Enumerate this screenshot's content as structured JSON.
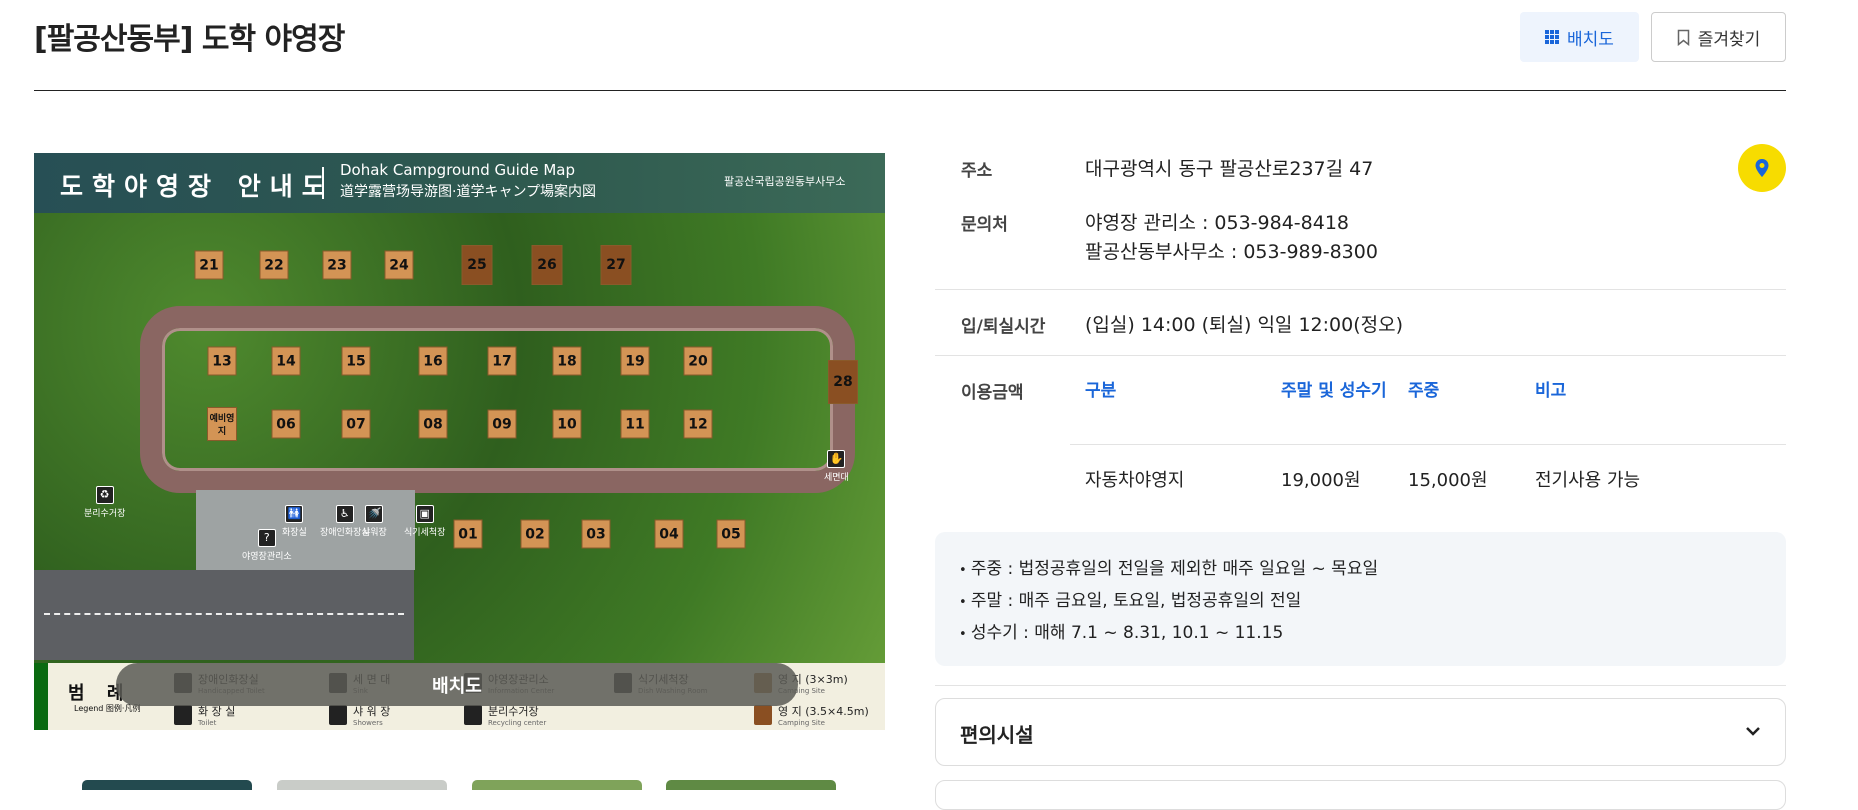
{
  "header": {
    "title": "[팔공산동부] 도학 야영장",
    "layout_button": "배치도",
    "favorite_button": "즐겨찾기"
  },
  "map": {
    "title_ko": "도학야영장 안내도",
    "title_en": "Dohak Campground Guide Map",
    "title_cn": "道学露营场导游图·道学キャンプ場案内図",
    "org": "팔공산국립공원동부사무소",
    "overlay_label": "배치도",
    "sites": [
      "21",
      "22",
      "23",
      "24",
      "25",
      "26",
      "27",
      "13",
      "14",
      "15",
      "16",
      "17",
      "18",
      "19",
      "20",
      "예비영지",
      "06",
      "07",
      "08",
      "09",
      "10",
      "11",
      "12",
      "28",
      "01",
      "02",
      "03",
      "04",
      "05"
    ],
    "facilities": [
      "화장실",
      "장애인화장실",
      "샤워장",
      "식기세척장",
      "야영장관리소",
      "분리수거장",
      "세면대"
    ],
    "legend": {
      "title": "범 례",
      "subtitle": "Legend 图例·凡例",
      "items": [
        {
          "ko": "장애인화장실",
          "en": "Handicapped Toilet",
          "icon": "wheelchair-icon"
        },
        {
          "ko": "세 면 대",
          "en": "Sink",
          "icon": "sink-icon"
        },
        {
          "ko": "야영장관리소",
          "en": "Information Center",
          "icon": "info-icon"
        },
        {
          "ko": "식기세척장",
          "en": "Dish Washing Room",
          "icon": "dish-icon"
        },
        {
          "ko": "화 장 실",
          "en": "Toilet",
          "icon": "toilet-icon"
        },
        {
          "ko": "샤 워 장",
          "en": "Showers",
          "icon": "shower-icon"
        },
        {
          "ko": "분리수거장",
          "en": "Recycling center",
          "icon": "recycle-icon"
        },
        {
          "ko": "영 지 (3×3m)",
          "en": "Camping Site",
          "icon": "site-small-icon"
        },
        {
          "ko": "영 지 (3.5×4.5m)",
          "en": "Camping Site",
          "icon": "site-large-icon"
        }
      ]
    }
  },
  "info": {
    "address_label": "주소",
    "address": "대구광역시 동구 팔공산로237길 47",
    "contact_label": "문의처",
    "contact_1": "야영장 관리소 : 053-984-8418",
    "contact_2": "팔공산동부사무소 : 053-989-8300",
    "checkin_label": "입/퇴실시간",
    "checkin": "(입실) 14:00 (퇴실) 익일 12:00(정오)",
    "fee_label": "이용금액",
    "fee_headers": [
      "구분",
      "주말 및 성수기",
      "주중",
      "비고"
    ],
    "fee_rows": [
      [
        "자동차야영지",
        "19,000원",
        "15,000원",
        "전기사용 가능"
      ]
    ],
    "notes": [
      "주중 : 법정공휴일의 전일을 제외한 매주 일요일 ~ 목요일",
      "주말 : 매주 금요일, 토요일, 법정공휴일의 전일",
      "성수기 : 매해 7.1 ~ 8.31, 10.1 ~ 11.15"
    ],
    "facilities_title": "편의시설"
  },
  "colors": {
    "accent": "#1a66d9",
    "pin": "#f7dc00",
    "site": "#d39455",
    "site_large": "#8a4f22"
  }
}
